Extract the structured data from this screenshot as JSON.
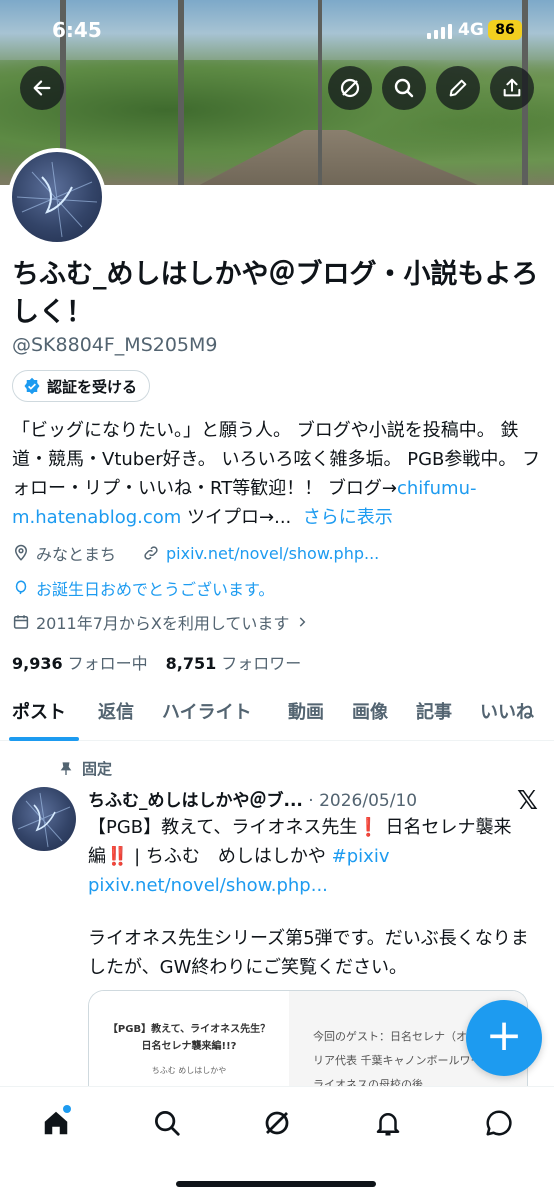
{
  "status_bar": {
    "time": "6:45",
    "network": "4G",
    "battery": "86"
  },
  "profile": {
    "display_name": "ちふむ_めしはしかや＠ブログ・小説もよろしく！",
    "handle": "@SK8804F_MS205M9",
    "verify_label": "認証を受ける",
    "bio_text": "「ビッグになりたい。」と願う人。 ブログや小説を投稿中。 鉄道・競馬・Vtuber好き。 いろいろ呟く雑多垢。 PGB参戦中。 フォロー・リプ・いいね・RT等歓迎！！ ブログ→",
    "bio_link": "chifumu-m.hatenablog.com",
    "bio_tail": " ツイプロ→...",
    "show_more": "さらに表示",
    "location": "みなとまち",
    "website": "pixiv.net/novel/show.php...",
    "birthday": "お誕生日おめでとうございます。",
    "joined": "2011年7月からXを利用しています",
    "following_count": "9,936",
    "following_label": "フォロー中",
    "followers_count": "8,751",
    "followers_label": "フォロワー"
  },
  "tabs": [
    "ポスト",
    "返信",
    "ハイライト",
    "動画",
    "画像",
    "記事",
    "いいね"
  ],
  "post": {
    "pinned_label": "固定",
    "author": "ちふむ_めしはしかや＠ブ...",
    "date": "· 2026/05/10",
    "body_prefix": "【PGB】教えて、ライオネス先生",
    "body_mid": " 日名セレナ襲来編",
    "body_after": " | ちふむ　めしはしかや ",
    "hashtag": "#pixiv",
    "body_link": " pixiv.net/novel/show.php...",
    "body2": "ライオネス先生シリーズ第5弾です。だいぶ長くなりましたが、GW終わりにご笑覧ください。",
    "card_title": "【PGB】教えて、ライオネス先生？ 日名セレナ襲来編!!?",
    "card_author": "ちふむ めしはしかや",
    "card_excerpt": "今回のゲスト：日名セレナ（オーストラリア代表 千葉キャノンボールワーズ所属 ライオネスの母校の後"
  },
  "fab_label": "+",
  "colors": {
    "accent": "#1d9bf0",
    "text": "#0f1419",
    "muted": "#536471"
  },
  "icons": [
    "back-arrow-icon",
    "grok-icon",
    "search-icon",
    "edit-icon",
    "share-icon",
    "location-icon",
    "link-icon",
    "balloon-icon",
    "calendar-icon",
    "pin-icon",
    "home-icon",
    "grok-icon",
    "bell-icon",
    "message-icon"
  ]
}
